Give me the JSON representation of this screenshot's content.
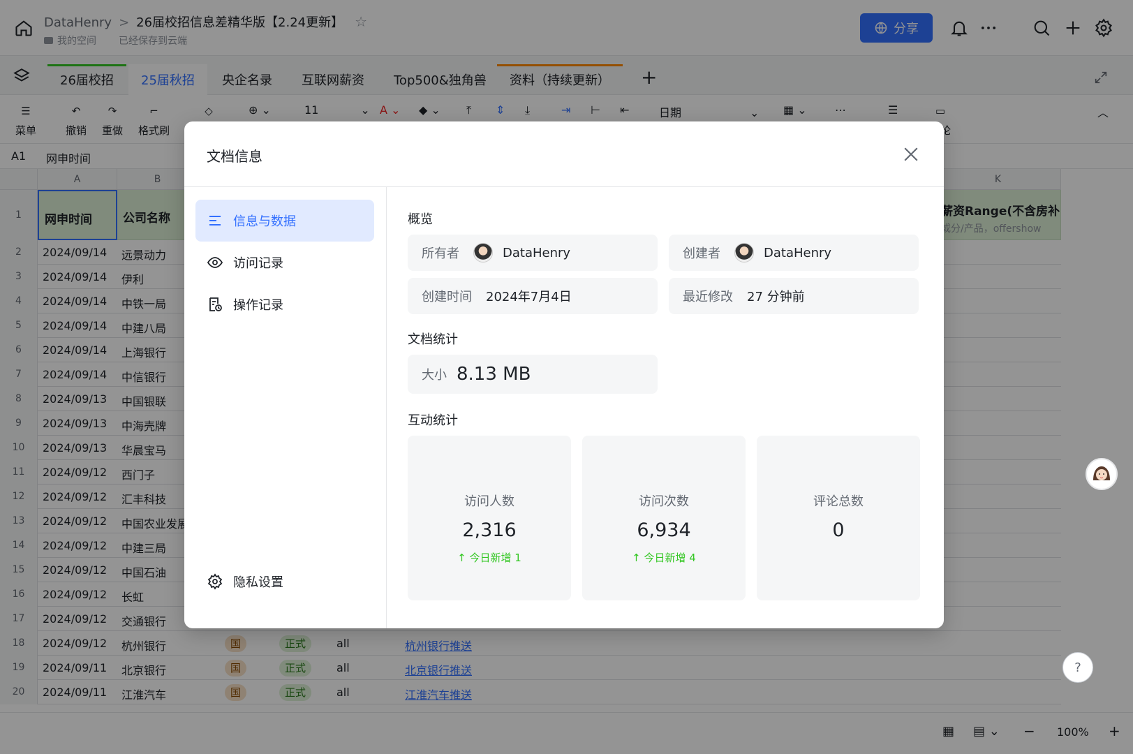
{
  "header": {
    "breadcrumb_owner": "DataHenry",
    "breadcrumb_sep": ">",
    "doc_title": "26届校招信息差精华版【2.24更新】",
    "space": "我的空间",
    "save_status": "已经保存到云端",
    "share_label": "分享"
  },
  "tabs": [
    {
      "label": "26届校招",
      "bar_color": "#34c724"
    },
    {
      "label": "25届秋招",
      "bar_color": ""
    },
    {
      "label": "央企名录",
      "bar_color": ""
    },
    {
      "label": "互联网薪资",
      "bar_color": ""
    },
    {
      "label": "Top500&独角兽",
      "bar_color": ""
    },
    {
      "label": "资料（持续更新）",
      "bar_color": "#ff8800"
    }
  ],
  "toolbar": {
    "menu": "菜单",
    "undo": "撤销",
    "redo": "重做",
    "format_painter": "格式刷",
    "font_size": "11",
    "number_format": "日期",
    "comment": "评论"
  },
  "formula_bar": {
    "cell_ref": "A1",
    "cell_value": "网申时间"
  },
  "grid": {
    "columns": [
      "A",
      "B",
      "K"
    ],
    "header_a": "网申时间",
    "header_b": "公司名称",
    "header_k": "薪资Range(不含房补",
    "header_k_sub": "或分/产品，offershow",
    "rows": [
      {
        "n": "2",
        "date": "2024/09/14",
        "company": "远景动力"
      },
      {
        "n": "3",
        "date": "2024/09/14",
        "company": "伊利"
      },
      {
        "n": "4",
        "date": "2024/09/14",
        "company": "中铁一局"
      },
      {
        "n": "5",
        "date": "2024/09/14",
        "company": "中建八局"
      },
      {
        "n": "6",
        "date": "2024/09/14",
        "company": "上海银行"
      },
      {
        "n": "7",
        "date": "2024/09/14",
        "company": "中信银行"
      },
      {
        "n": "8",
        "date": "2024/09/13",
        "company": "中国银联"
      },
      {
        "n": "9",
        "date": "2024/09/13",
        "company": "中海壳牌"
      },
      {
        "n": "10",
        "date": "2024/09/13",
        "company": "华晨宝马"
      },
      {
        "n": "11",
        "date": "2024/09/12",
        "company": "西门子"
      },
      {
        "n": "12",
        "date": "2024/09/12",
        "company": "汇丰科技"
      },
      {
        "n": "13",
        "date": "2024/09/12",
        "company": "中国农业发展"
      },
      {
        "n": "14",
        "date": "2024/09/12",
        "company": "中建三局"
      },
      {
        "n": "15",
        "date": "2024/09/12",
        "company": "中国石油"
      },
      {
        "n": "16",
        "date": "2024/09/12",
        "company": "长虹"
      },
      {
        "n": "17",
        "date": "2024/09/12",
        "company": "交通银行"
      },
      {
        "n": "18",
        "date": "2024/09/12",
        "company": "杭州银行",
        "type": "国",
        "status": "正式",
        "scope": "all",
        "link": "杭州银行推送"
      },
      {
        "n": "19",
        "date": "2024/09/11",
        "company": "北京银行",
        "type": "国",
        "status": "正式",
        "scope": "all",
        "link": "北京银行推送"
      },
      {
        "n": "20",
        "date": "2024/09/11",
        "company": "江淮汽车",
        "type": "国",
        "status": "正式",
        "scope": "all",
        "link": "江淮汽车推送"
      }
    ]
  },
  "bottom": {
    "zoom": "100%"
  },
  "modal": {
    "title": "文档信息",
    "nav": {
      "info": "信息与数据",
      "visits": "访问记录",
      "operations": "操作记录",
      "privacy": "隐私设置"
    },
    "overview_title": "概览",
    "owner_label": "所有者",
    "owner_name": "DataHenry",
    "creator_label": "创建者",
    "creator_name": "DataHenry",
    "created_label": "创建时间",
    "created_value": "2024年7月4日",
    "modified_label": "最近修改",
    "modified_value": "27 分钟前",
    "stats_title": "文档统计",
    "size_label": "大小",
    "size_value": "8.13 MB",
    "interaction_title": "互动统计",
    "stats": [
      {
        "label": "访问人数",
        "value": "2,316",
        "delta": "↑ 今日新增 1"
      },
      {
        "label": "访问次数",
        "value": "6,934",
        "delta": "↑ 今日新增 4"
      },
      {
        "label": "评论总数",
        "value": "0",
        "delta": ""
      }
    ]
  },
  "colors": {
    "accent": "#3370ff",
    "positive": "#34c724",
    "header_green": "#dcf0d6"
  }
}
